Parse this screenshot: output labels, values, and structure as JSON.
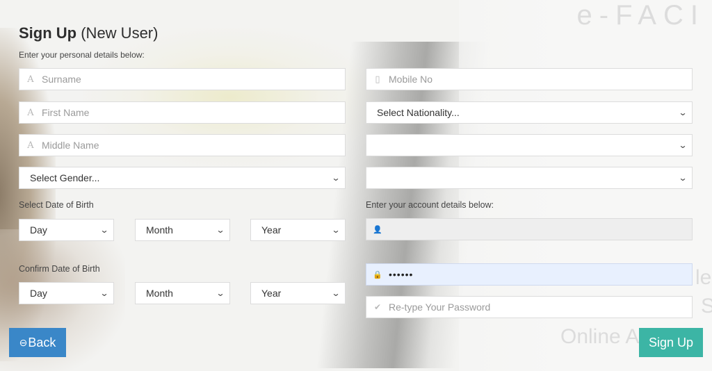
{
  "header": {
    "title_strong": "Sign Up",
    "title_rest": "(New User)",
    "subtitle": "Enter your personal details below:"
  },
  "watermark": {
    "top": "e-FACI",
    "right_1": "le",
    "right_2": "S",
    "right_3": "Online Ac  L"
  },
  "personal": {
    "surname_placeholder": "Surname",
    "first_name_placeholder": "First Name",
    "middle_name_placeholder": "Middle Name",
    "gender_value": "Select Gender...",
    "dob_label": "Select Date of Birth",
    "dob": {
      "day": "Day",
      "month": "Month",
      "year": "Year"
    },
    "confirm_dob_label": "Confirm Date of Birth",
    "confirm_dob": {
      "day": "Day",
      "month": "Month",
      "year": "Year"
    }
  },
  "contact": {
    "mobile_placeholder": "Mobile No",
    "nationality_value": "Select Nationality...",
    "select_2_value": "",
    "select_3_value": ""
  },
  "account": {
    "label": "Enter your account details below:",
    "username_value": "",
    "password_value": "••••••",
    "retype_placeholder": "Re-type Your Password"
  },
  "buttons": {
    "back_icon": "⊖",
    "back_label": "Back",
    "signup_label": "Sign Up"
  },
  "icons": {
    "person_text": "A",
    "mobile": "▯",
    "user": "👤",
    "lock": "🔒",
    "check": "✔",
    "chevron": "⌄"
  },
  "colors": {
    "back_button": "#3a87c8",
    "signup_button": "#3cb5a5",
    "autofill": "#e8f0fe"
  }
}
